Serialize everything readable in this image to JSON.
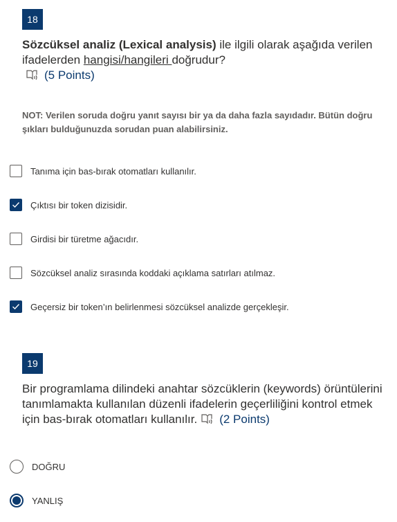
{
  "accent_color": "#0b3a6e",
  "q18": {
    "number": "18",
    "title_bold": "Sözcüksel analiz (Lexical analysis)",
    "title_part1": " ile ilgili olarak aşağıda verilen ifadelerden ",
    "title_underlined": "hangisi/hangileri ",
    "title_part2": "doğrudur?",
    "immersive_reader_icon": "immersive-reader-icon",
    "points": "(5 Points)",
    "note": "NOT: Verilen soruda doğru yanıt sayısı bir ya da daha fazla sayıdadır. Bütün doğru şıkları bulduğunuzda sorudan puan alabilirsiniz.",
    "options": [
      {
        "label": "Tanıma için bas-bırak otomatları kullanılır.",
        "checked": false
      },
      {
        "label": "Çıktısı bir token dizisidir.",
        "checked": true
      },
      {
        "label": "Girdisi bir türetme ağacıdır.",
        "checked": false
      },
      {
        "label": "Sözcüksel analiz sırasında koddaki açıklama satırları atılmaz.",
        "checked": false
      },
      {
        "label": "Geçersiz bir token’ın belirlenmesi sözcüksel analizde gerçekleşir.",
        "checked": true
      }
    ]
  },
  "q19": {
    "number": "19",
    "title": "Bir programlama dilindeki anahtar sözcüklerin (keywords) örüntülerini tanımlamakta kullanılan düzenli ifadelerin geçerliliğini kontrol etmek için bas-bırak otomatları kullanılır.",
    "immersive_reader_icon": "immersive-reader-icon",
    "points": "(2 Points)",
    "options": [
      {
        "label": "DOĞRU",
        "selected": false
      },
      {
        "label": "YANLIŞ",
        "selected": true
      }
    ]
  }
}
